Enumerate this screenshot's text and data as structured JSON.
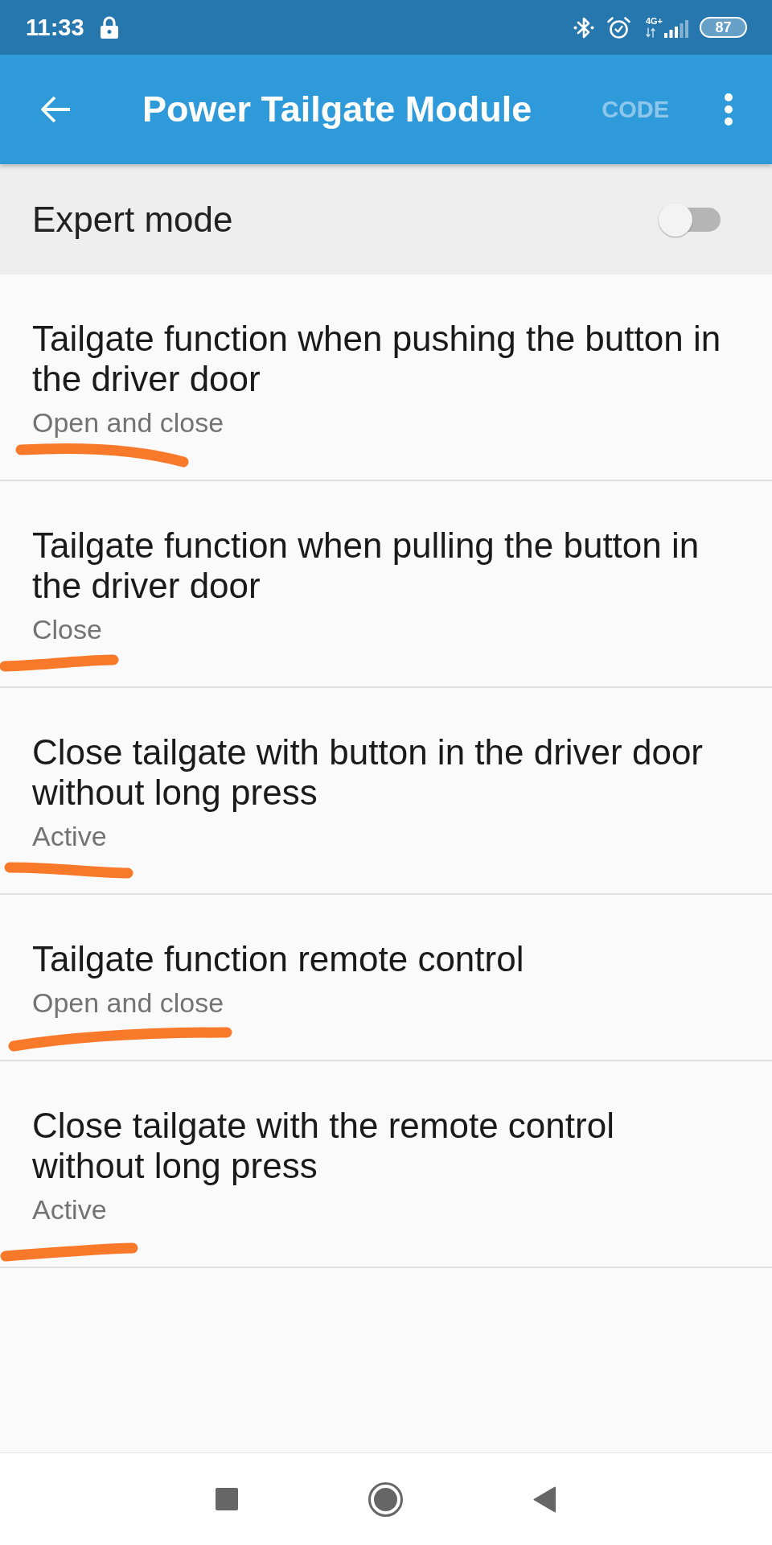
{
  "status_bar": {
    "time": "11:33",
    "network": "4G+",
    "battery": "87"
  },
  "app_bar": {
    "title": "Power Tailgate Module",
    "action": {
      "label": "CODE",
      "disabled": true
    }
  },
  "expert_mode": {
    "label": "Expert mode",
    "on": false
  },
  "settings": [
    {
      "title": "Tailgate function when pushing the button in the driver door",
      "value": "Open and close",
      "underlined": true
    },
    {
      "title": "Tailgate function when pulling the button in the driver door",
      "value": "Close",
      "underlined": true
    },
    {
      "title": "Close tailgate with button in the driver door without long press",
      "value": "Active",
      "underlined": true
    },
    {
      "title": "Tailgate function remote control",
      "value": "Open and close",
      "underlined": true
    },
    {
      "title": "Close tailgate with the remote control without long press",
      "value": "Active",
      "underlined": true
    }
  ]
}
